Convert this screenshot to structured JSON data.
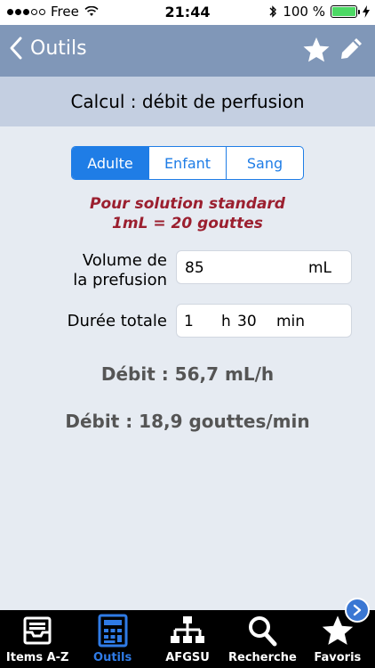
{
  "status_bar": {
    "carrier": "Free",
    "time": "21:44",
    "battery": "100 %"
  },
  "nav": {
    "back_label": "Outils",
    "star_icon": "star-icon",
    "edit_icon": "pencil-icon"
  },
  "page": {
    "title": "Calcul : débit de perfusion"
  },
  "segments": {
    "items": [
      "Adulte",
      "Enfant",
      "Sang"
    ],
    "selected": "Adulte"
  },
  "notice": {
    "line1": "Pour solution standard",
    "line2": "1mL = 20 gouttes"
  },
  "volume": {
    "label_line1": "Volume de",
    "label_line2": "la prefusion",
    "value": "85",
    "unit": "mL"
  },
  "duree": {
    "label": "Durée totale",
    "hours": "1",
    "hours_unit": "h",
    "minutes": "30",
    "minutes_unit": "min"
  },
  "results": {
    "debit_ml": "Débit : 56,7 mL/h",
    "debit_gouttes": "Débit : 18,9 gouttes/min"
  },
  "tabs": [
    {
      "label": "Items A-Z",
      "icon": "inbox-icon"
    },
    {
      "label": "Outils",
      "icon": "calculator-icon"
    },
    {
      "label": "AFGSU",
      "icon": "hierarchy-icon"
    },
    {
      "label": "Recherche",
      "icon": "search-icon"
    },
    {
      "label": "Favoris",
      "icon": "star-icon"
    }
  ],
  "colors": {
    "nav": "#8097b8",
    "title_band": "#c4cfe1",
    "background": "#e6ebf2",
    "accent": "#1f7de6",
    "notice": "#9b1f2f"
  }
}
